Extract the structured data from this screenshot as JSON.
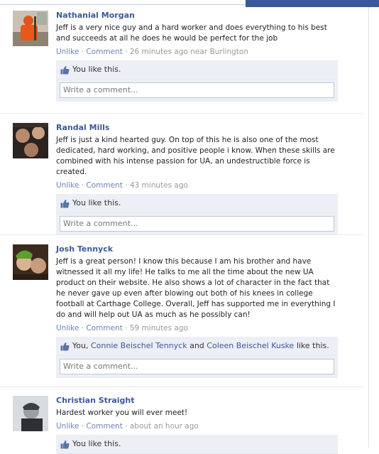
{
  "stories": [
    {
      "author": "Nathanial Morgan",
      "message": "Jeff is a very nice guy and a hard worker and does everything to his best and succeeds at all he does he would be perfect for the job",
      "actions": {
        "unlike": "Unlike",
        "comment": "Comment"
      },
      "time": "26 minutes ago near Burlington",
      "likes_text": "You like this.",
      "comment_placeholder": "Write a comment..."
    },
    {
      "author": "Randal Mills",
      "message": "Jeff is just a kind hearted guy. On top of this he is also one of the most dedicated, hard working, and positive people i know. When these skills are combined with his intense passion for UA, an undestructible force is created.",
      "actions": {
        "unlike": "Unlike",
        "comment": "Comment"
      },
      "time": "43 minutes ago",
      "likes_text": "You like this.",
      "comment_placeholder": "Write a comment..."
    },
    {
      "author": "Josh Tennyck",
      "message": "Jeff is a great person! I know this because I am his brother and have witnessed it all my life! He talks to me all the time about the new UA product on their website. He also shows a lot of character in the fact that he never gave up even after blowing out both of his knees in college football at Carthage College. Overall, Jeff has supported me in everything I do and will help out UA as much as he possibly can!",
      "actions": {
        "unlike": "Unlike",
        "comment": "Comment"
      },
      "time": "59 minutes ago",
      "likes_prefix": "You,",
      "liker_1": "Connie Beischel Tennyck",
      "likes_and": "and",
      "liker_2": "Coleen Beischel Kuske",
      "likes_suffix": "like this.",
      "comment_placeholder": "Write a comment..."
    },
    {
      "author": "Christian Straight",
      "message": "Hardest worker you will ever meet!",
      "actions": {
        "unlike": "Unlike",
        "comment": "Comment"
      },
      "time": "about an hour ago",
      "likes_text": "You like this."
    }
  ],
  "separator": "·",
  "icons": {
    "like": "thumbs-up-icon"
  },
  "colors": {
    "link": "#3b5998",
    "meta": "#999999",
    "ufi_bg": "#eceff5"
  }
}
